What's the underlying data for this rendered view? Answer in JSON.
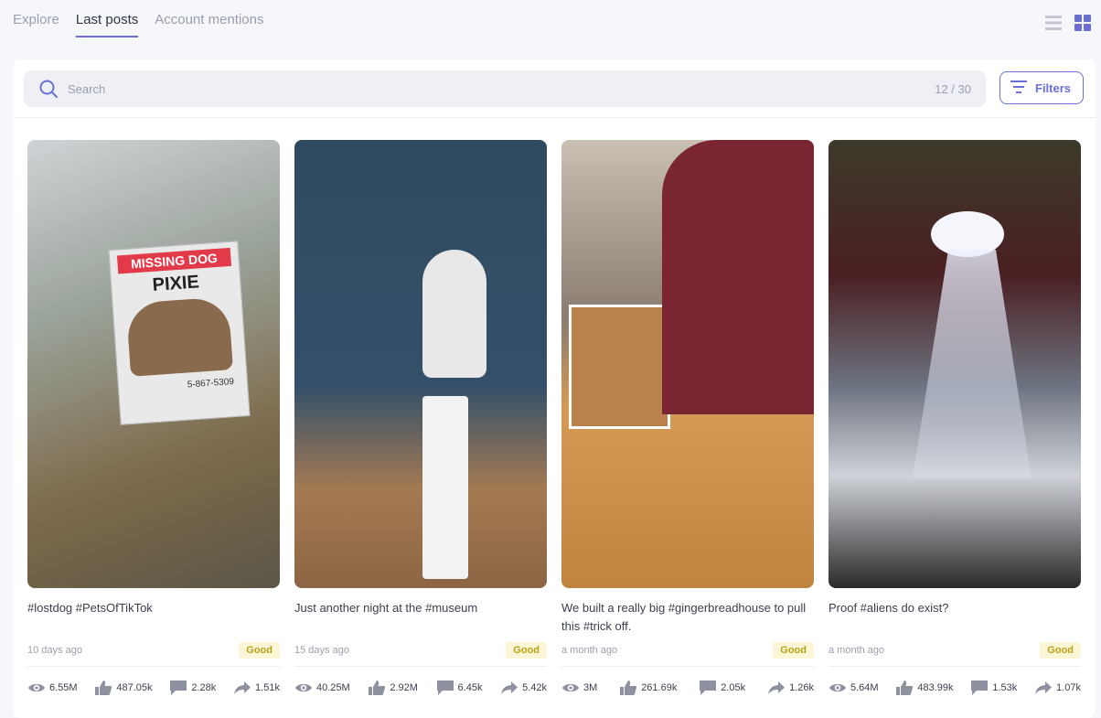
{
  "tabs": [
    {
      "label": "Explore",
      "active": false
    },
    {
      "label": "Last posts",
      "active": true
    },
    {
      "label": "Account mentions",
      "active": false
    }
  ],
  "view_toggle": {
    "list_icon": "list-view-icon",
    "grid_icon": "grid-view-icon",
    "active": "grid"
  },
  "search": {
    "placeholder": "Search",
    "value": "",
    "count": "12 / 30"
  },
  "filters": {
    "label": "Filters",
    "icon": "filter-icon"
  },
  "colors": {
    "accent": "#6b6fd3",
    "badge_text": "#b8a21a",
    "badge_bg": "#faf6d6"
  },
  "posts": [
    {
      "caption": "#lostdog #PetsOfTikTok",
      "age": "10 days ago",
      "rating": "Good",
      "views": "6.55M",
      "likes": "487.05k",
      "comments": "2.28k",
      "shares": "1.51k",
      "thumb_bg": "linear-gradient(160deg,#cfd3d6 0%,#9aa39a 35%,#7d6a4a 70%,#5b5647 100%)",
      "sign_top": "MISSING DOG",
      "sign_name": "PIXIE",
      "sign_phone": "5-867-5309"
    },
    {
      "caption": "Just another night at the #museum",
      "age": "15 days ago",
      "rating": "Good",
      "views": "40.25M",
      "likes": "2.92M",
      "comments": "6.45k",
      "shares": "5.42k",
      "thumb_bg": "linear-gradient(180deg,#2f4a5e 0%,#34506a 55%,#a47a52 78%,#8c6543 100%)"
    },
    {
      "caption": "We built a really big #gingerbreadhouse to pull this #trick off.",
      "age": "a month ago",
      "rating": "Good",
      "views": "3M",
      "likes": "261.69k",
      "comments": "2.05k",
      "shares": "1.26k",
      "thumb_bg": "linear-gradient(180deg,#c9bfb2 0%,#8a7c70 40%,#d49a56 60%,#c0843f 100%)"
    },
    {
      "caption": "Proof #aliens do exist?",
      "age": "a month ago",
      "rating": "Good",
      "views": "5.64M",
      "likes": "483.99k",
      "comments": "1.53k",
      "shares": "1.07k",
      "thumb_bg": "linear-gradient(180deg,#3c3a2a 0%,#4a1f22 30%,#6d7380 55%,#cfd2d8 75%,#2a2a2a 100%)"
    }
  ]
}
